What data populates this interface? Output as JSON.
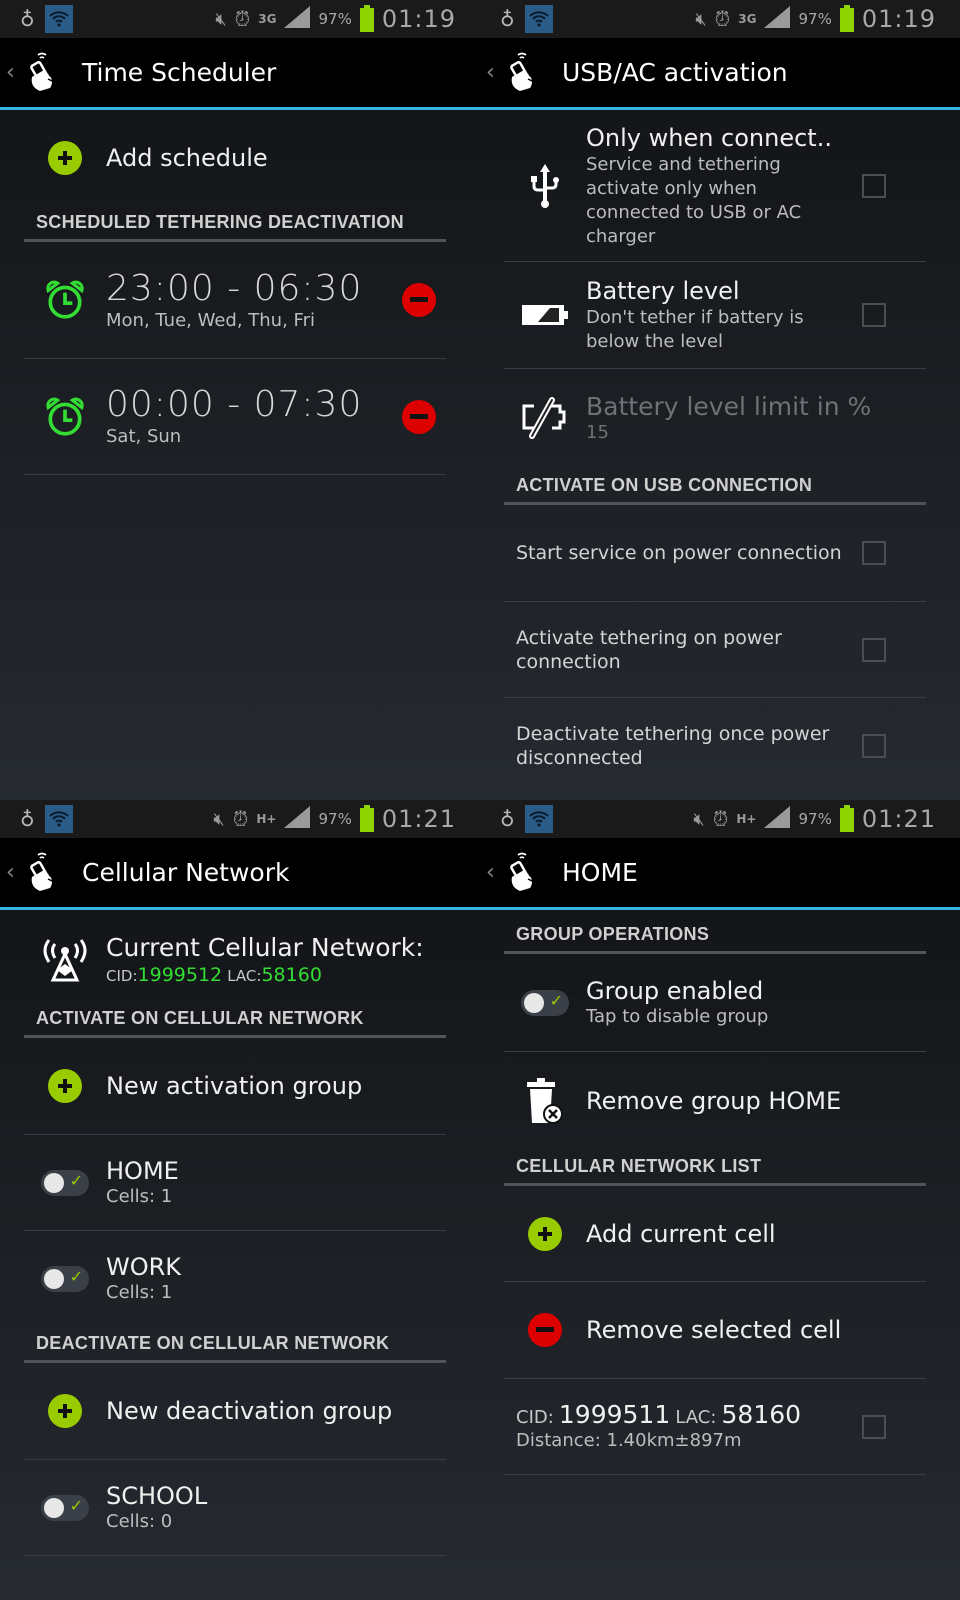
{
  "status_bars": [
    {
      "time": "01:19",
      "network": "3G",
      "battery_percent": "97%"
    },
    {
      "time": "01:19",
      "network": "3G",
      "battery_percent": "97%"
    },
    {
      "time": "01:21",
      "network": "H+",
      "battery_percent": "97%"
    },
    {
      "time": "01:21",
      "network": "H+",
      "battery_percent": "97%"
    }
  ],
  "colors": {
    "accent": "#33b5e5",
    "add_green": "#99cc00",
    "remove_red": "#dd0000",
    "alarm_green": "#33dd33",
    "battery_green": "#8fd400"
  },
  "time_scheduler": {
    "title": "Time Scheduler",
    "add_label": "Add schedule",
    "section_header": "SCHEDULED TETHERING DEACTIVATION",
    "schedules": [
      {
        "range": "23:00 - 06:30",
        "days": "Mon, Tue, Wed, Thu, Fri"
      },
      {
        "range": "00:00 - 07:30",
        "days": "Sat, Sun"
      }
    ]
  },
  "usb_ac": {
    "title": "USB/AC activation",
    "only_when_connected": {
      "title": "Only when connect..",
      "summary": "Service and tethering activate only when connected to USB or AC charger",
      "checked": false
    },
    "battery_level": {
      "title": "Battery level",
      "summary": "Don't tether if battery is below the level",
      "checked": false
    },
    "battery_limit": {
      "title": "Battery level limit in %",
      "value": "15"
    },
    "section_header": "ACTIVATE ON USB CONNECTION",
    "options": [
      {
        "label": "Start service on power connection",
        "checked": false
      },
      {
        "label": "Activate tethering on power connection",
        "checked": false
      },
      {
        "label": "Deactivate tethering once power disconnected",
        "checked": false
      }
    ]
  },
  "cellular": {
    "title": "Cellular Network",
    "current_label": "Current Cellular Network:",
    "cid_label": "CID:",
    "cid_value": "1999512",
    "lac_label": "LAC:",
    "lac_value": "58160",
    "activate_header": "ACTIVATE ON CELLULAR NETWORK",
    "new_activation_label": "New activation group",
    "activation_groups": [
      {
        "name": "HOME",
        "cells": "Cells: 1"
      },
      {
        "name": "WORK",
        "cells": "Cells: 1"
      }
    ],
    "deactivate_header": "DEACTIVATE ON CELLULAR NETWORK",
    "new_deactivation_label": "New deactivation group",
    "deactivation_groups": [
      {
        "name": "SCHOOL",
        "cells": "Cells: 0"
      }
    ]
  },
  "home_group": {
    "title": "HOME",
    "ops_header": "GROUP OPERATIONS",
    "enabled_title": "Group enabled",
    "enabled_summary": "Tap to disable group",
    "remove_label": "Remove group HOME",
    "list_header": "CELLULAR NETWORK LIST",
    "add_cell_label": "Add current cell",
    "remove_cell_label": "Remove selected cell",
    "cell": {
      "cid_label": "CID:",
      "cid_value": "1999511",
      "lac_label": "LAC:",
      "lac_value": "58160",
      "distance": "Distance: 1.40km±897m",
      "checked": false
    }
  }
}
